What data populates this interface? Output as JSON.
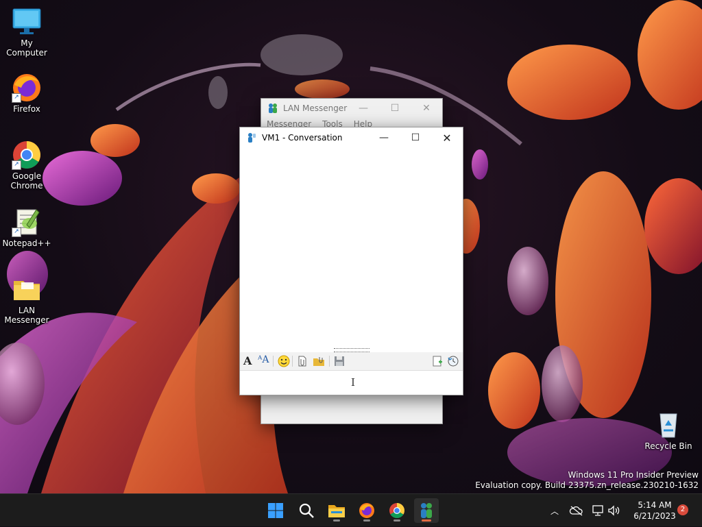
{
  "desktop": {
    "icons": [
      {
        "label": "My Computer",
        "icon": "monitor-icon"
      },
      {
        "label": "Firefox",
        "icon": "firefox-icon"
      },
      {
        "label": "Google Chrome",
        "icon": "chrome-icon"
      },
      {
        "label": "Notepad++",
        "icon": "notepadpp-icon"
      },
      {
        "label": "LAN Messenger",
        "icon": "folder-icon"
      },
      {
        "label": "Recycle Bin",
        "icon": "recycle-bin-icon"
      }
    ],
    "watermark": {
      "line1": "Windows 11 Pro Insider Preview",
      "line2": "Evaluation copy. Build 23375.zn_release.230210-1632"
    }
  },
  "main_window": {
    "title": "LAN Messenger",
    "menu": [
      "Messenger",
      "Tools",
      "Help"
    ]
  },
  "conversation_window": {
    "title": "VM1 - Conversation",
    "message_input_value": "",
    "toolbar_icons": [
      "font-icon",
      "font-color-icon",
      "smiley-icon",
      "send-file-icon",
      "send-folder-icon",
      "save-icon",
      "paste-icon",
      "history-icon"
    ]
  },
  "taskbar": {
    "apps": [
      "start-icon",
      "search-icon",
      "file-explorer-icon",
      "firefox-icon",
      "chrome-icon",
      "lan-messenger-icon"
    ],
    "clock_time": "5:14 AM",
    "clock_date": "6/21/2023",
    "notification_count": "2"
  },
  "colors": {
    "accent": "#e06b43",
    "taskbar": "#1c1c1c"
  }
}
